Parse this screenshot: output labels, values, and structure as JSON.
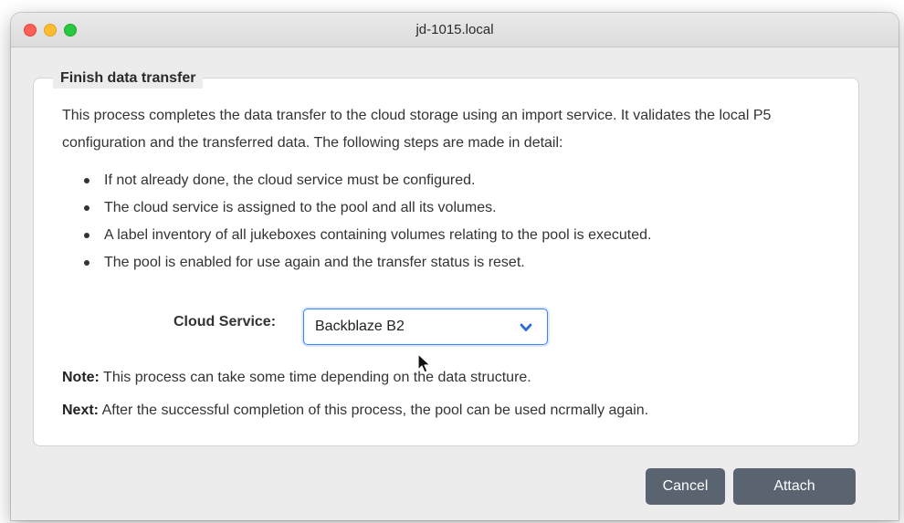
{
  "window": {
    "title": "jd-1015.local"
  },
  "panel": {
    "heading": "Finish data transfer",
    "description": "This process completes the data transfer to the cloud storage using an import service. It validates the local P5 configuration and the transferred data. The following steps are made in detail:",
    "steps": [
      "If not already done, the cloud service must be configured.",
      "The cloud service is assigned to the pool and all its volumes.",
      "A label inventory of all jukeboxes containing volumes relating to the pool is executed.",
      "The pool is enabled for use again and the transfer status is reset."
    ],
    "cloud_service": {
      "label": "Cloud Service:",
      "selected": "Backblaze B2",
      "icon": "chevron-down-icon"
    },
    "note": {
      "label": "Note:",
      "text": "This process can take some time depending on the data structure."
    },
    "next": {
      "label": "Next:",
      "text": "After the successful completion of this process, the pool can be used ncrmally again."
    }
  },
  "buttons": {
    "cancel": "Cancel",
    "attach": "Attach"
  },
  "colors": {
    "select_focus": "#3b82f6",
    "button_bg": "#5a6470",
    "chevron": "#2f6fd6",
    "traffic_close": "#fe5f57",
    "traffic_min": "#febc2e",
    "traffic_max": "#28c840"
  }
}
